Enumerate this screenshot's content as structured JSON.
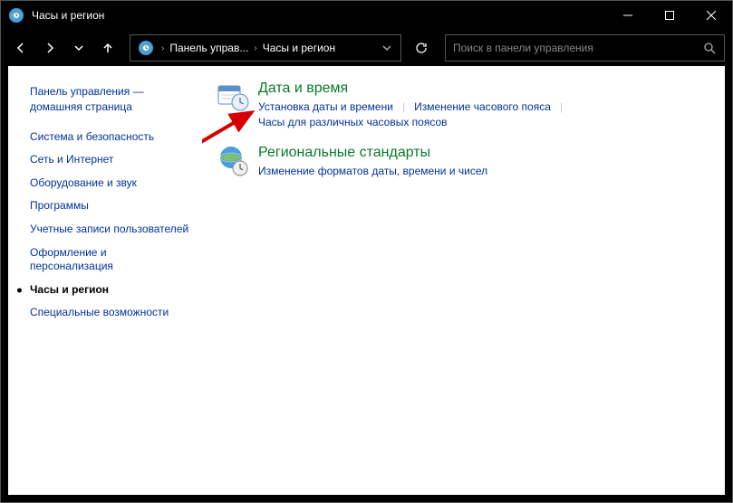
{
  "window": {
    "title": "Часы и регион"
  },
  "breadcrumb": {
    "seg1": "Панель управ...",
    "seg2": "Часы и регион"
  },
  "search": {
    "placeholder": "Поиск в панели управления"
  },
  "sidebar": {
    "home": "Панель управления — домашняя страница",
    "items": [
      {
        "label": "Система и безопасность"
      },
      {
        "label": "Сеть и Интернет"
      },
      {
        "label": "Оборудование и звук"
      },
      {
        "label": "Программы"
      },
      {
        "label": "Учетные записи пользователей"
      },
      {
        "label": "Оформление и персонализация"
      },
      {
        "label": "Часы и регион"
      },
      {
        "label": "Специальные возможности"
      }
    ]
  },
  "main": {
    "cat1": {
      "title": "Дата и время",
      "link1": "Установка даты и времени",
      "link2": "Изменение часового пояса",
      "link3": "Часы для различных часовых поясов"
    },
    "cat2": {
      "title": "Региональные стандарты",
      "link1": "Изменение форматов даты, времени и чисел"
    }
  }
}
